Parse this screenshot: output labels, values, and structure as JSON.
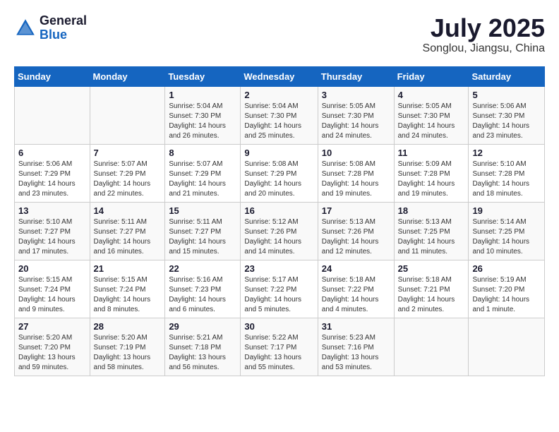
{
  "header": {
    "logo_general": "General",
    "logo_blue": "Blue",
    "month_title": "July 2025",
    "location": "Songlou, Jiangsu, China"
  },
  "weekdays": [
    "Sunday",
    "Monday",
    "Tuesday",
    "Wednesday",
    "Thursday",
    "Friday",
    "Saturday"
  ],
  "weeks": [
    [
      {
        "day": "",
        "info": ""
      },
      {
        "day": "",
        "info": ""
      },
      {
        "day": "1",
        "info": "Sunrise: 5:04 AM\nSunset: 7:30 PM\nDaylight: 14 hours and 26 minutes."
      },
      {
        "day": "2",
        "info": "Sunrise: 5:04 AM\nSunset: 7:30 PM\nDaylight: 14 hours and 25 minutes."
      },
      {
        "day": "3",
        "info": "Sunrise: 5:05 AM\nSunset: 7:30 PM\nDaylight: 14 hours and 24 minutes."
      },
      {
        "day": "4",
        "info": "Sunrise: 5:05 AM\nSunset: 7:30 PM\nDaylight: 14 hours and 24 minutes."
      },
      {
        "day": "5",
        "info": "Sunrise: 5:06 AM\nSunset: 7:30 PM\nDaylight: 14 hours and 23 minutes."
      }
    ],
    [
      {
        "day": "6",
        "info": "Sunrise: 5:06 AM\nSunset: 7:29 PM\nDaylight: 14 hours and 23 minutes."
      },
      {
        "day": "7",
        "info": "Sunrise: 5:07 AM\nSunset: 7:29 PM\nDaylight: 14 hours and 22 minutes."
      },
      {
        "day": "8",
        "info": "Sunrise: 5:07 AM\nSunset: 7:29 PM\nDaylight: 14 hours and 21 minutes."
      },
      {
        "day": "9",
        "info": "Sunrise: 5:08 AM\nSunset: 7:29 PM\nDaylight: 14 hours and 20 minutes."
      },
      {
        "day": "10",
        "info": "Sunrise: 5:08 AM\nSunset: 7:28 PM\nDaylight: 14 hours and 19 minutes."
      },
      {
        "day": "11",
        "info": "Sunrise: 5:09 AM\nSunset: 7:28 PM\nDaylight: 14 hours and 19 minutes."
      },
      {
        "day": "12",
        "info": "Sunrise: 5:10 AM\nSunset: 7:28 PM\nDaylight: 14 hours and 18 minutes."
      }
    ],
    [
      {
        "day": "13",
        "info": "Sunrise: 5:10 AM\nSunset: 7:27 PM\nDaylight: 14 hours and 17 minutes."
      },
      {
        "day": "14",
        "info": "Sunrise: 5:11 AM\nSunset: 7:27 PM\nDaylight: 14 hours and 16 minutes."
      },
      {
        "day": "15",
        "info": "Sunrise: 5:11 AM\nSunset: 7:27 PM\nDaylight: 14 hours and 15 minutes."
      },
      {
        "day": "16",
        "info": "Sunrise: 5:12 AM\nSunset: 7:26 PM\nDaylight: 14 hours and 14 minutes."
      },
      {
        "day": "17",
        "info": "Sunrise: 5:13 AM\nSunset: 7:26 PM\nDaylight: 14 hours and 12 minutes."
      },
      {
        "day": "18",
        "info": "Sunrise: 5:13 AM\nSunset: 7:25 PM\nDaylight: 14 hours and 11 minutes."
      },
      {
        "day": "19",
        "info": "Sunrise: 5:14 AM\nSunset: 7:25 PM\nDaylight: 14 hours and 10 minutes."
      }
    ],
    [
      {
        "day": "20",
        "info": "Sunrise: 5:15 AM\nSunset: 7:24 PM\nDaylight: 14 hours and 9 minutes."
      },
      {
        "day": "21",
        "info": "Sunrise: 5:15 AM\nSunset: 7:24 PM\nDaylight: 14 hours and 8 minutes."
      },
      {
        "day": "22",
        "info": "Sunrise: 5:16 AM\nSunset: 7:23 PM\nDaylight: 14 hours and 6 minutes."
      },
      {
        "day": "23",
        "info": "Sunrise: 5:17 AM\nSunset: 7:22 PM\nDaylight: 14 hours and 5 minutes."
      },
      {
        "day": "24",
        "info": "Sunrise: 5:18 AM\nSunset: 7:22 PM\nDaylight: 14 hours and 4 minutes."
      },
      {
        "day": "25",
        "info": "Sunrise: 5:18 AM\nSunset: 7:21 PM\nDaylight: 14 hours and 2 minutes."
      },
      {
        "day": "26",
        "info": "Sunrise: 5:19 AM\nSunset: 7:20 PM\nDaylight: 14 hours and 1 minute."
      }
    ],
    [
      {
        "day": "27",
        "info": "Sunrise: 5:20 AM\nSunset: 7:20 PM\nDaylight: 13 hours and 59 minutes."
      },
      {
        "day": "28",
        "info": "Sunrise: 5:20 AM\nSunset: 7:19 PM\nDaylight: 13 hours and 58 minutes."
      },
      {
        "day": "29",
        "info": "Sunrise: 5:21 AM\nSunset: 7:18 PM\nDaylight: 13 hours and 56 minutes."
      },
      {
        "day": "30",
        "info": "Sunrise: 5:22 AM\nSunset: 7:17 PM\nDaylight: 13 hours and 55 minutes."
      },
      {
        "day": "31",
        "info": "Sunrise: 5:23 AM\nSunset: 7:16 PM\nDaylight: 13 hours and 53 minutes."
      },
      {
        "day": "",
        "info": ""
      },
      {
        "day": "",
        "info": ""
      }
    ]
  ]
}
